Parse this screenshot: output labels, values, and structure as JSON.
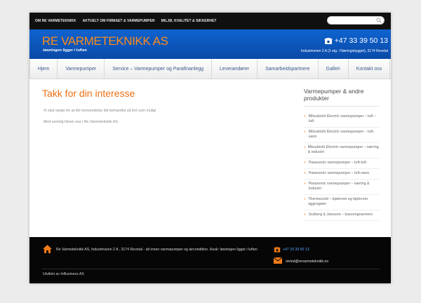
{
  "topnav": [
    "OM RE VARMETEKNIKK",
    "AKTUELT OM FIRMAET & VARMEPUMPER",
    "MILJØ, KVALITET & SIKKERHET"
  ],
  "search": {
    "placeholder": ""
  },
  "header": {
    "brand": "RE VARMETEKNIKK AS",
    "tagline": "-løsningen ligger i luften",
    "phone": "+47 33 39 50 13",
    "address": "Industriveien 2 A (2 etg. i Næringsbygget), 3174 Revetal"
  },
  "mainnav": [
    "Hjem",
    "Varmepumper",
    "Service – Varmepumper og Parafinanlegg",
    "Leverandører",
    "Samarbeidspartnere",
    "Galleri",
    "Kontakt oss"
  ],
  "main": {
    "title": "Takk for din interesse",
    "text1": "Vi skal sørge for at din henvendelse blir behandlet så fort som mulig!",
    "text2": "Med vennlig hilsen oss i Re Varmeteknikk AS."
  },
  "sidebar": {
    "title": "Varmepumper & andre produkter",
    "bullet": "»",
    "items": [
      "Mitsubishi Electric varmepumper – luft – luft",
      "Mitsubishi Electric varmepumper – luft-vann",
      "Mitsubishi Electric varmepumper – næring & industri",
      "Panasonic varmepumper – luft-luft",
      "Panasonic varmepumper – luft-vann",
      "Panasonic varmepumper – næring & industri",
      "Thermocold – kjølerom og kjølerom aggregater",
      "Gulberg & Jansson – bassengvarmere"
    ]
  },
  "footer": {
    "text": "Re Varmeteknikk AS, Industriveien 2 A , 3174 Revetal - alt innen varmepumper og aircondition. Husk: løsningen ligger i luften",
    "phone": "+47 33 39 50 13",
    "email": "oivind@revarmeteknikk.no",
    "credit": "Utviklet av InBusiness AS"
  },
  "colors": {
    "accent_orange": "#ea6e12",
    "header_blue": "#0e63cf",
    "topbar_black": "#101010",
    "footer_black": "#060606"
  }
}
